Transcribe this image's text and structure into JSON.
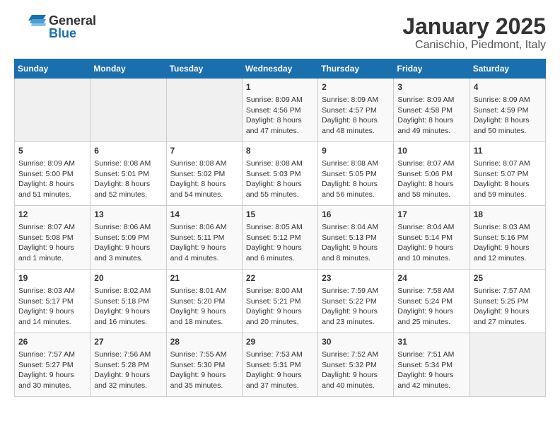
{
  "header": {
    "logo_general": "General",
    "logo_blue": "Blue",
    "title": "January 2025",
    "subtitle": "Canischio, Piedmont, Italy"
  },
  "calendar": {
    "days_of_week": [
      "Sunday",
      "Monday",
      "Tuesday",
      "Wednesday",
      "Thursday",
      "Friday",
      "Saturday"
    ],
    "weeks": [
      [
        {
          "day": "",
          "info": ""
        },
        {
          "day": "",
          "info": ""
        },
        {
          "day": "",
          "info": ""
        },
        {
          "day": "1",
          "info": "Sunrise: 8:09 AM\nSunset: 4:56 PM\nDaylight: 8 hours\nand 47 minutes."
        },
        {
          "day": "2",
          "info": "Sunrise: 8:09 AM\nSunset: 4:57 PM\nDaylight: 8 hours\nand 48 minutes."
        },
        {
          "day": "3",
          "info": "Sunrise: 8:09 AM\nSunset: 4:58 PM\nDaylight: 8 hours\nand 49 minutes."
        },
        {
          "day": "4",
          "info": "Sunrise: 8:09 AM\nSunset: 4:59 PM\nDaylight: 8 hours\nand 50 minutes."
        }
      ],
      [
        {
          "day": "5",
          "info": "Sunrise: 8:09 AM\nSunset: 5:00 PM\nDaylight: 8 hours\nand 51 minutes."
        },
        {
          "day": "6",
          "info": "Sunrise: 8:08 AM\nSunset: 5:01 PM\nDaylight: 8 hours\nand 52 minutes."
        },
        {
          "day": "7",
          "info": "Sunrise: 8:08 AM\nSunset: 5:02 PM\nDaylight: 8 hours\nand 54 minutes."
        },
        {
          "day": "8",
          "info": "Sunrise: 8:08 AM\nSunset: 5:03 PM\nDaylight: 8 hours\nand 55 minutes."
        },
        {
          "day": "9",
          "info": "Sunrise: 8:08 AM\nSunset: 5:05 PM\nDaylight: 8 hours\nand 56 minutes."
        },
        {
          "day": "10",
          "info": "Sunrise: 8:07 AM\nSunset: 5:06 PM\nDaylight: 8 hours\nand 58 minutes."
        },
        {
          "day": "11",
          "info": "Sunrise: 8:07 AM\nSunset: 5:07 PM\nDaylight: 8 hours\nand 59 minutes."
        }
      ],
      [
        {
          "day": "12",
          "info": "Sunrise: 8:07 AM\nSunset: 5:08 PM\nDaylight: 9 hours\nand 1 minute."
        },
        {
          "day": "13",
          "info": "Sunrise: 8:06 AM\nSunset: 5:09 PM\nDaylight: 9 hours\nand 3 minutes."
        },
        {
          "day": "14",
          "info": "Sunrise: 8:06 AM\nSunset: 5:11 PM\nDaylight: 9 hours\nand 4 minutes."
        },
        {
          "day": "15",
          "info": "Sunrise: 8:05 AM\nSunset: 5:12 PM\nDaylight: 9 hours\nand 6 minutes."
        },
        {
          "day": "16",
          "info": "Sunrise: 8:04 AM\nSunset: 5:13 PM\nDaylight: 9 hours\nand 8 minutes."
        },
        {
          "day": "17",
          "info": "Sunrise: 8:04 AM\nSunset: 5:14 PM\nDaylight: 9 hours\nand 10 minutes."
        },
        {
          "day": "18",
          "info": "Sunrise: 8:03 AM\nSunset: 5:16 PM\nDaylight: 9 hours\nand 12 minutes."
        }
      ],
      [
        {
          "day": "19",
          "info": "Sunrise: 8:03 AM\nSunset: 5:17 PM\nDaylight: 9 hours\nand 14 minutes."
        },
        {
          "day": "20",
          "info": "Sunrise: 8:02 AM\nSunset: 5:18 PM\nDaylight: 9 hours\nand 16 minutes."
        },
        {
          "day": "21",
          "info": "Sunrise: 8:01 AM\nSunset: 5:20 PM\nDaylight: 9 hours\nand 18 minutes."
        },
        {
          "day": "22",
          "info": "Sunrise: 8:00 AM\nSunset: 5:21 PM\nDaylight: 9 hours\nand 20 minutes."
        },
        {
          "day": "23",
          "info": "Sunrise: 7:59 AM\nSunset: 5:22 PM\nDaylight: 9 hours\nand 23 minutes."
        },
        {
          "day": "24",
          "info": "Sunrise: 7:58 AM\nSunset: 5:24 PM\nDaylight: 9 hours\nand 25 minutes."
        },
        {
          "day": "25",
          "info": "Sunrise: 7:57 AM\nSunset: 5:25 PM\nDaylight: 9 hours\nand 27 minutes."
        }
      ],
      [
        {
          "day": "26",
          "info": "Sunrise: 7:57 AM\nSunset: 5:27 PM\nDaylight: 9 hours\nand 30 minutes."
        },
        {
          "day": "27",
          "info": "Sunrise: 7:56 AM\nSunset: 5:28 PM\nDaylight: 9 hours\nand 32 minutes."
        },
        {
          "day": "28",
          "info": "Sunrise: 7:55 AM\nSunset: 5:30 PM\nDaylight: 9 hours\nand 35 minutes."
        },
        {
          "day": "29",
          "info": "Sunrise: 7:53 AM\nSunset: 5:31 PM\nDaylight: 9 hours\nand 37 minutes."
        },
        {
          "day": "30",
          "info": "Sunrise: 7:52 AM\nSunset: 5:32 PM\nDaylight: 9 hours\nand 40 minutes."
        },
        {
          "day": "31",
          "info": "Sunrise: 7:51 AM\nSunset: 5:34 PM\nDaylight: 9 hours\nand 42 minutes."
        },
        {
          "day": "",
          "info": ""
        }
      ]
    ]
  }
}
